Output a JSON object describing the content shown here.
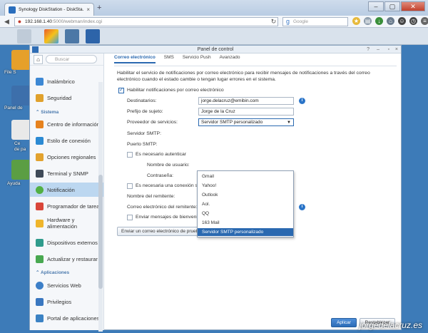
{
  "browser": {
    "tab_title": "Synology DiskStation - DiskSta...",
    "url_host": "192.168.1.40",
    "url_rest": ":5000/webman/index.cgi",
    "search_placeholder": "Google"
  },
  "desktop": {
    "labels": [
      "File S",
      "Panel de",
      "Ce",
      "de pa",
      "Ayuda"
    ]
  },
  "window": {
    "title": "Panel de control"
  },
  "sidebar": {
    "search_placeholder": "Buscar",
    "items": [
      {
        "label": "Inalámbrico"
      },
      {
        "label": "Seguridad"
      },
      {
        "label": "Centro de información"
      },
      {
        "label": "Estilo de conexión"
      },
      {
        "label": "Opciones regionales"
      },
      {
        "label": "Terminal y SNMP"
      },
      {
        "label": "Notificación"
      },
      {
        "label": "Programador de tareas"
      },
      {
        "label": "Hardware y alimentación",
        "line1": "Hardware y",
        "line2": "alimentación"
      },
      {
        "label": "Dispositivos externos"
      },
      {
        "label": "Actualizar y restaurar"
      },
      {
        "label": "Servicios Web"
      },
      {
        "label": "Privilegios"
      },
      {
        "label": "Portal de aplicaciones"
      }
    ],
    "sections": {
      "sistema": "Sistema",
      "aplicaciones": "Aplicaciones"
    }
  },
  "tabs": [
    "Correo electrónico",
    "SMS",
    "Servicio Push",
    "Avanzado"
  ],
  "form": {
    "intro": "Habilitar el servicio de notificaciones por correo electrónico para recibir mensajes de notificaciones a través del correo electrónico cuando el estado cambie o tengan lugar errores en el sistema.",
    "enable_label": "Habilitar notificaciones por correo electrónico",
    "destinatarios_label": "Destinatarios:",
    "destinatarios_value": "jorge.delacruz@emibin.com",
    "prefijo_label": "Prefijo de sujeto:",
    "prefijo_value": "Jorge de la Cruz",
    "proveedor_label": "Proveedor de servicios:",
    "proveedor_value": "Servidor SMTP personalizado",
    "servidor_label": "Servidor SMTP:",
    "puerto_label": "Puerto SMTP:",
    "auth_label": "Es necesario autenticar",
    "usuario_label": "Nombre de usuario:",
    "password_label": "Contraseña:",
    "secure_label": "Es necesaria una conexión se",
    "remitente_label": "Nombre del remitente:",
    "remitente_email_label": "Correo electrónico del remitente:",
    "welcome_label": "Enviar mensajes de bienvenida a usuarios nuevos",
    "test_button": "Enviar un correo electrónico de prueba"
  },
  "dropdown": {
    "options": [
      "Gmail",
      "Yahoo!",
      "Outlook",
      "Aol.",
      "QQ",
      "163 Mail",
      "Servidor SMTP personalizado"
    ],
    "selected": "Servidor SMTP personalizado"
  },
  "footer": {
    "apply": "Aplicar",
    "reset": "Restablecer"
  },
  "watermark": "jorgedelacruz.es"
}
